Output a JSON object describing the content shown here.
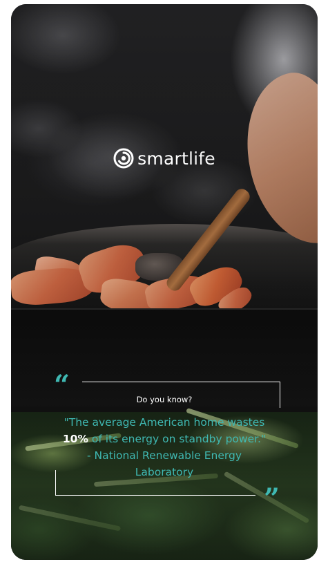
{
  "brand": {
    "name_part1": "smart",
    "name_part2": "life"
  },
  "quote": {
    "kicker": "Do you know?",
    "text_before": "\"The average American home wastes ",
    "highlight": "10%",
    "text_after": " of its energy on standby power.\" - National Renewable Energy Laboratory",
    "open_mark": "“",
    "close_mark": "”"
  },
  "colors": {
    "accent": "#3fb8b2",
    "text_light": "#ffffff",
    "background": "#141414"
  },
  "icons": {
    "logo": "smartlife-spiral-logo-icon",
    "open_quote": "open-quote-icon",
    "close_quote": "close-quote-icon"
  }
}
